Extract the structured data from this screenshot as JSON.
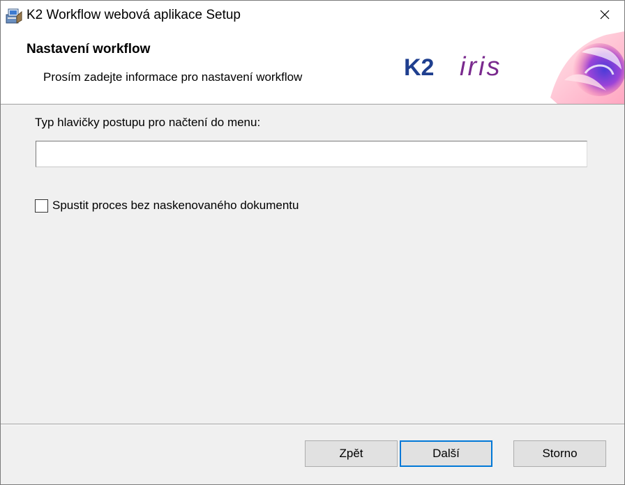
{
  "window": {
    "title": "K2 Workflow webová aplikace Setup"
  },
  "header": {
    "title": "Nastavení workflow",
    "subtitle": "Prosím zadejte informace pro nastavení workflow",
    "logo_text_k2": "K2",
    "logo_text_iris": "iris"
  },
  "form": {
    "field_label": "Typ hlavičky postupu pro načtení do menu:",
    "field_value": "",
    "checkbox_label": "Spustit proces bez naskenovaného dokumentu",
    "checkbox_checked": false
  },
  "footer": {
    "back_label": "Zpět",
    "next_label": "Další",
    "cancel_label": "Storno"
  },
  "colors": {
    "k2_blue": "#1f3f8f",
    "iris_purple": "#7a2a8e",
    "default_button_border": "#0078d7"
  },
  "icons": {
    "app": "installer-icon",
    "close": "close-icon",
    "decor": "decorative-swirl-icon"
  }
}
